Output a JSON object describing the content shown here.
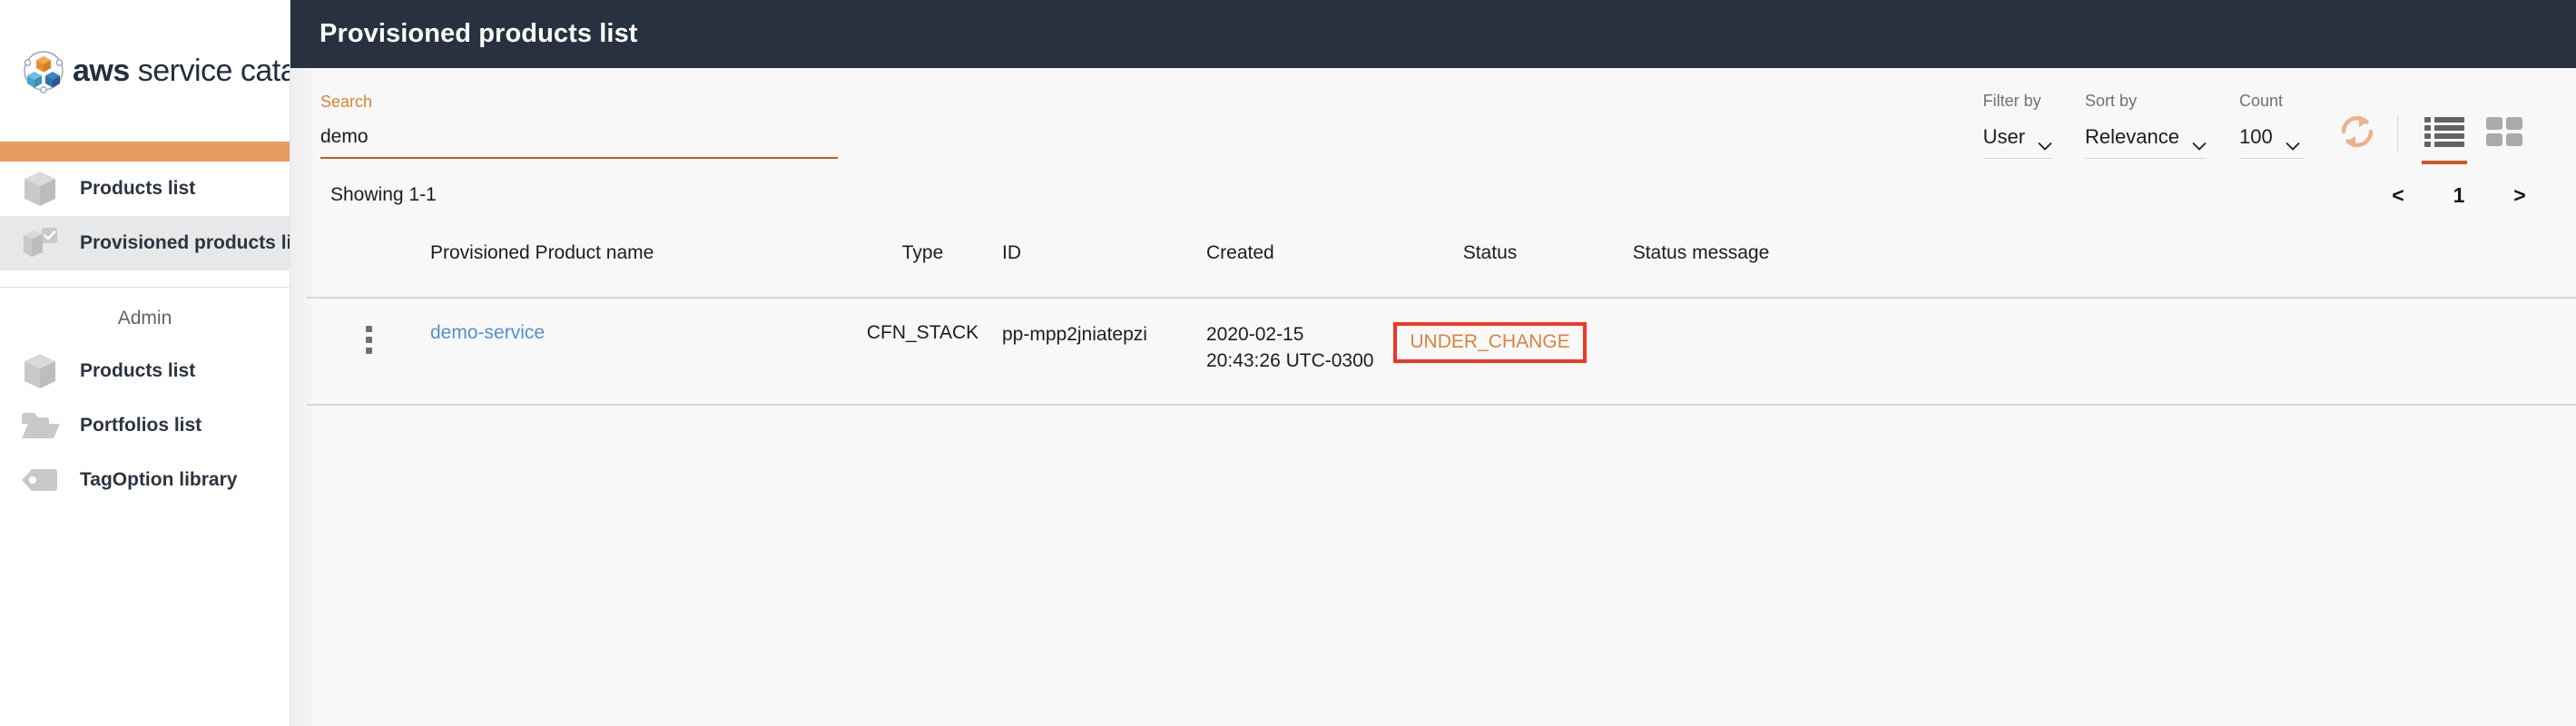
{
  "brand": {
    "name_bold": "aws",
    "name_light": " service catalog",
    "logo_icon": "aws-service-catalog-logo",
    "accent_color": "#e89a63"
  },
  "sidebar": {
    "primary_items": [
      {
        "label": "Products list",
        "icon": "cube-icon",
        "active": false
      },
      {
        "label": "Provisioned products list",
        "icon": "cube-check-icon",
        "active": true
      }
    ],
    "section_label": "Admin",
    "admin_items": [
      {
        "label": "Products list",
        "icon": "cube-icon"
      },
      {
        "label": "Portfolios list",
        "icon": "folder-icon"
      },
      {
        "label": "TagOption library",
        "icon": "tag-icon"
      }
    ]
  },
  "header": {
    "title": "Provisioned products list",
    "background": "#28313f"
  },
  "search": {
    "label": "Search",
    "value": "demo",
    "placeholder": "",
    "underline_color": "#c25b22"
  },
  "filters": [
    {
      "label": "Filter by",
      "value": "User",
      "name": "filter-by"
    },
    {
      "label": "Sort by",
      "value": "Relevance",
      "name": "sort-by"
    },
    {
      "label": "Count",
      "value": "100",
      "name": "count"
    }
  ],
  "toolbar": {
    "refresh_icon": "refresh-icon",
    "list_view_icon": "list-view-icon",
    "grid_view_icon": "grid-view-icon",
    "active_view": "list",
    "active_underline_color": "#c9591f"
  },
  "pagination": {
    "showing": "Showing 1-1",
    "prev": "<",
    "current_page": "1",
    "next": ">"
  },
  "table": {
    "columns": [
      {
        "key": "menu",
        "label": ""
      },
      {
        "key": "name",
        "label": "Provisioned Product name"
      },
      {
        "key": "type",
        "label": "Type"
      },
      {
        "key": "id",
        "label": "ID"
      },
      {
        "key": "created",
        "label": "Created"
      },
      {
        "key": "status",
        "label": "Status"
      },
      {
        "key": "message",
        "label": "Status message"
      }
    ],
    "rows": [
      {
        "name": "demo-service",
        "type": "CFN_STACK",
        "id": "pp-mpp2jniatepzi",
        "created": "2020-02-15 20:43:26 UTC-0300",
        "status": "UNDER_CHANGE",
        "status_color": "#d9843c",
        "status_highlight_color": "#f03725",
        "message": ""
      }
    ]
  }
}
